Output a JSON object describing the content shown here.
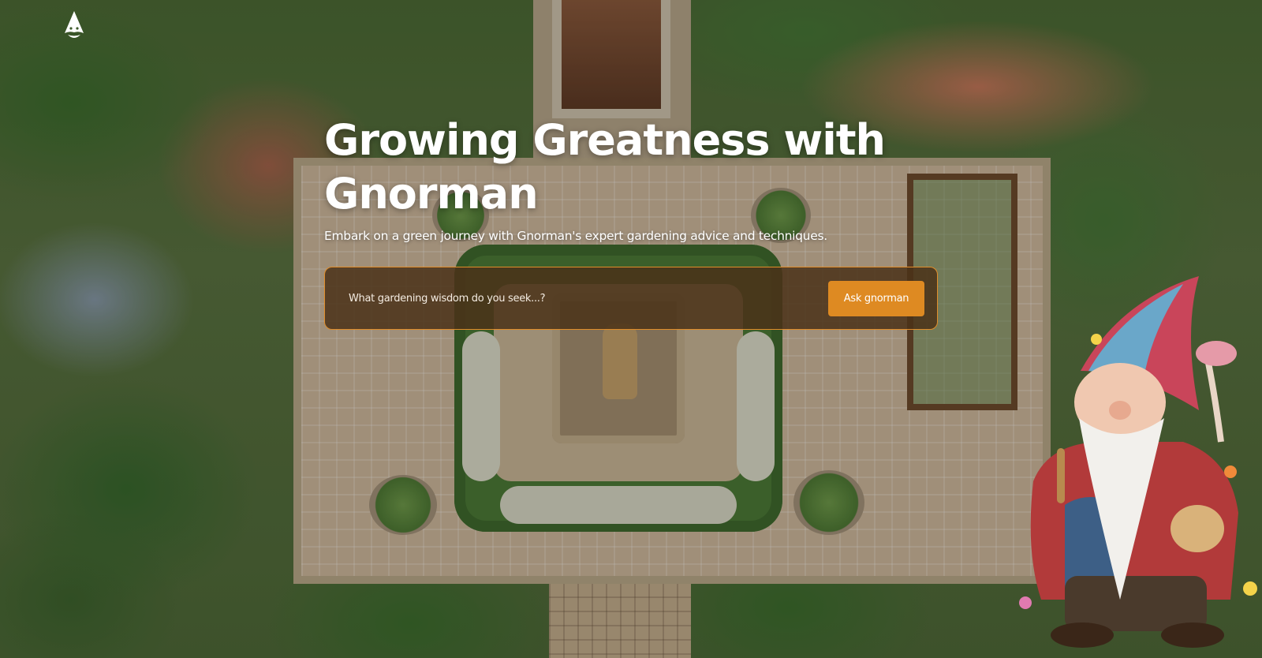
{
  "brand": {
    "logo_icon": "gnome-hat-logo-icon"
  },
  "hero": {
    "title": "Growing Greatness with Gnorman",
    "subtitle": "Embark on a green journey with Gnorman's expert gardening advice and techniques."
  },
  "search": {
    "placeholder": "What gardening wisdom do you seek...?",
    "value": "",
    "button_label": "Ask gnorman"
  },
  "colors": {
    "accent": "#de8a22",
    "panel_border": "#e08d2a",
    "panel_background": "#4a3218",
    "text": "#ffffff"
  }
}
